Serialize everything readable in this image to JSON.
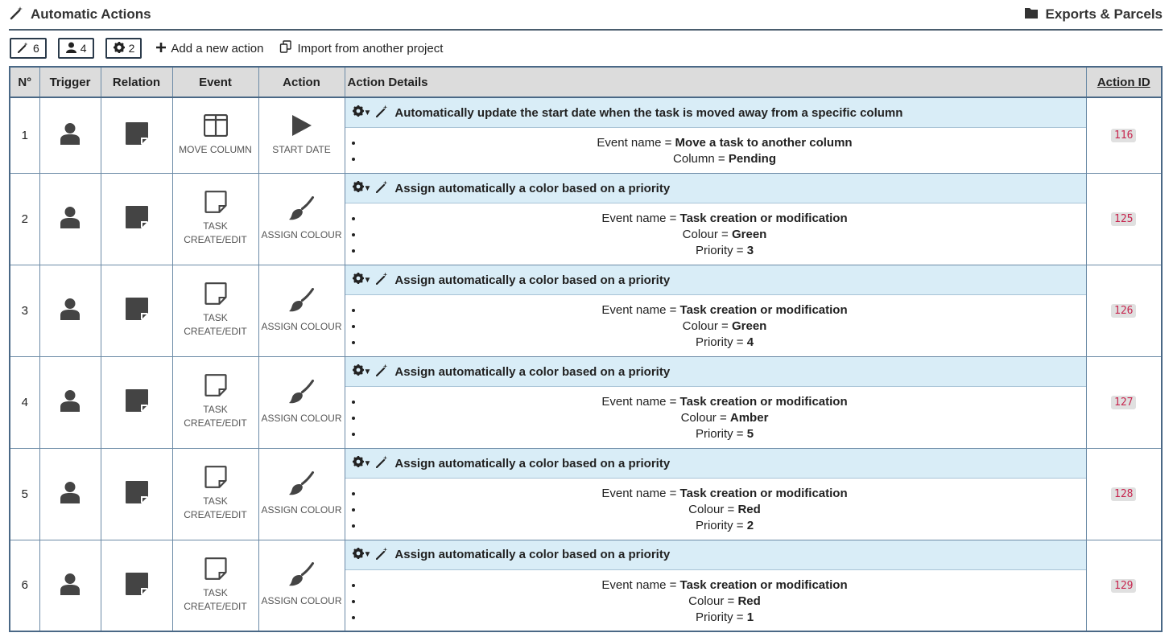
{
  "header": {
    "title": "Automatic Actions",
    "link": "Exports & Parcels"
  },
  "toolbar": {
    "counters": [
      {
        "icon": "wand-icon",
        "count": "6"
      },
      {
        "icon": "user-icon",
        "count": "4"
      },
      {
        "icon": "gear-icon",
        "count": "2"
      }
    ],
    "add_label": "Add a new action",
    "import_label": "Import from another project"
  },
  "table": {
    "headers": {
      "num": "N°",
      "trigger": "Trigger",
      "relation": "Relation",
      "event": "Event",
      "action": "Action",
      "details": "Action Details",
      "id": "Action ID"
    },
    "rows": [
      {
        "num": "1",
        "event_caption": "MOVE COLUMN",
        "action_caption": "START DATE",
        "title": "Automatically update the start date when the task is moved away from a specific column",
        "params": [
          {
            "label": "Event name = ",
            "value": "Move a task to another column"
          },
          {
            "label": "Column = ",
            "value": "Pending"
          }
        ],
        "id": "116"
      },
      {
        "num": "2",
        "event_caption": "TASK CREATE/EDIT",
        "action_caption": "ASSIGN COLOUR",
        "title": "Assign automatically a color based on a priority",
        "params": [
          {
            "label": "Event name = ",
            "value": "Task creation or modification"
          },
          {
            "label": "Colour = ",
            "value": "Green"
          },
          {
            "label": "Priority = ",
            "value": "3"
          }
        ],
        "id": "125"
      },
      {
        "num": "3",
        "event_caption": "TASK CREATE/EDIT",
        "action_caption": "ASSIGN COLOUR",
        "title": "Assign automatically a color based on a priority",
        "params": [
          {
            "label": "Event name = ",
            "value": "Task creation or modification"
          },
          {
            "label": "Colour = ",
            "value": "Green"
          },
          {
            "label": "Priority = ",
            "value": "4"
          }
        ],
        "id": "126"
      },
      {
        "num": "4",
        "event_caption": "TASK CREATE/EDIT",
        "action_caption": "ASSIGN COLOUR",
        "title": "Assign automatically a color based on a priority",
        "params": [
          {
            "label": "Event name = ",
            "value": "Task creation or modification"
          },
          {
            "label": "Colour = ",
            "value": "Amber"
          },
          {
            "label": "Priority = ",
            "value": "5"
          }
        ],
        "id": "127"
      },
      {
        "num": "5",
        "event_caption": "TASK CREATE/EDIT",
        "action_caption": "ASSIGN COLOUR",
        "title": "Assign automatically a color based on a priority",
        "params": [
          {
            "label": "Event name = ",
            "value": "Task creation or modification"
          },
          {
            "label": "Colour = ",
            "value": "Red"
          },
          {
            "label": "Priority = ",
            "value": "2"
          }
        ],
        "id": "128"
      },
      {
        "num": "6",
        "event_caption": "TASK CREATE/EDIT",
        "action_caption": "ASSIGN COLOUR",
        "title": "Assign automatically a color based on a priority",
        "params": [
          {
            "label": "Event name = ",
            "value": "Task creation or modification"
          },
          {
            "label": "Colour = ",
            "value": "Red"
          },
          {
            "label": "Priority = ",
            "value": "1"
          }
        ],
        "id": "129"
      }
    ]
  },
  "colors": {
    "header_bg": "#dcdcdc",
    "details_header_bg": "#d9edf7",
    "border": "#4a6886",
    "id_text": "#c7254e",
    "id_bg": "#e0e0e0"
  }
}
